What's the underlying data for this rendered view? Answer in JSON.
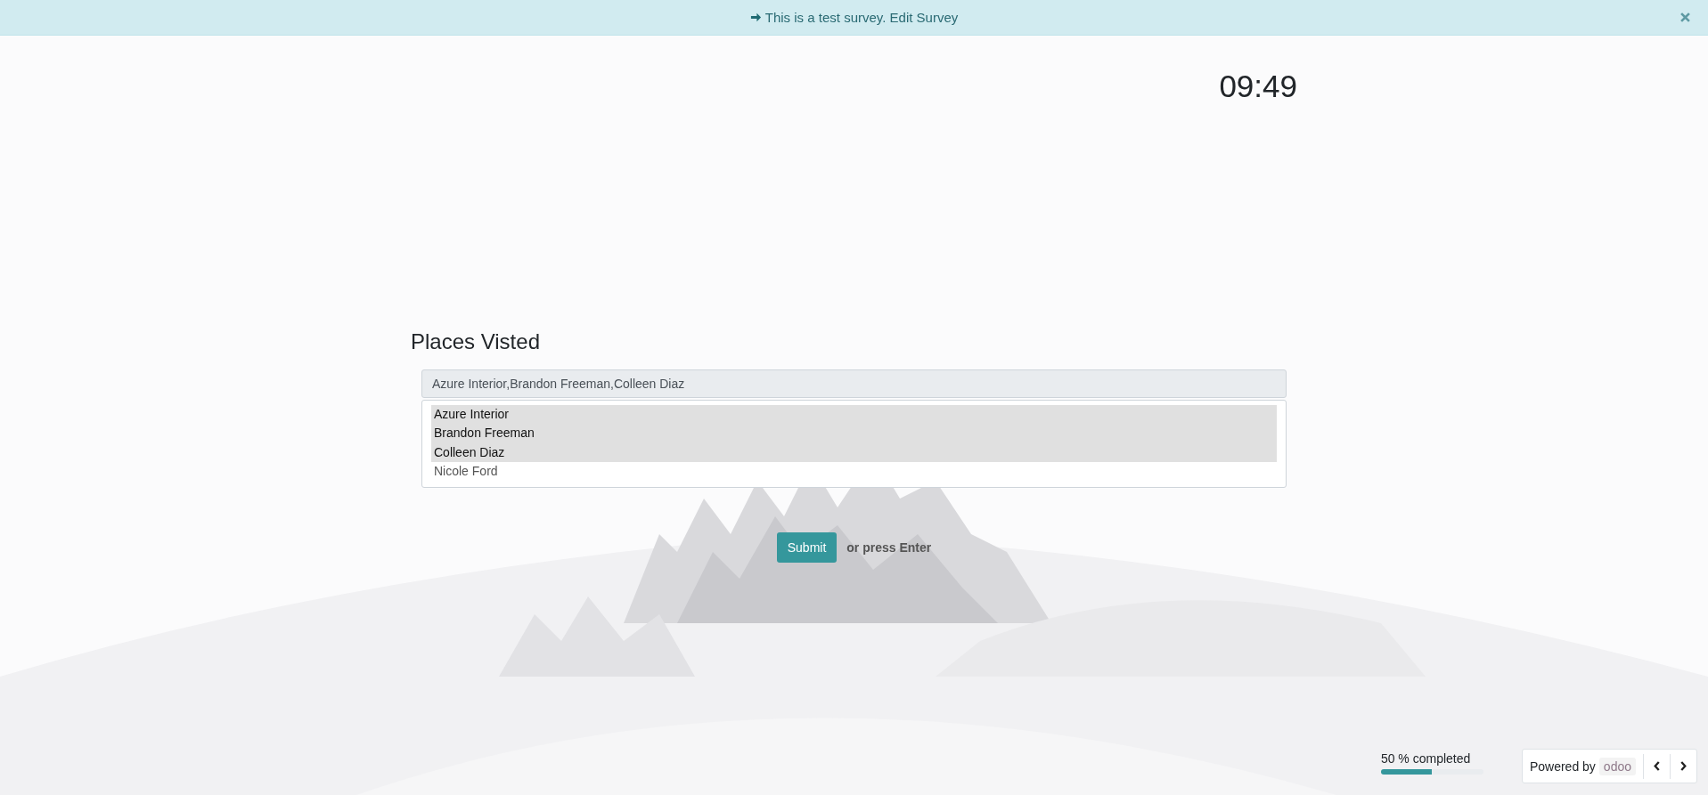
{
  "banner": {
    "message": "This is a test survey.",
    "link": "Edit Survey"
  },
  "timer": "09:49",
  "question": {
    "title": "Places Visted",
    "value": "Azure Interior,Brandon Freeman,Colleen Diaz",
    "options": [
      {
        "label": "Azure Interior",
        "selected": true
      },
      {
        "label": "Brandon Freeman",
        "selected": true
      },
      {
        "label": "Colleen Diaz",
        "selected": true
      },
      {
        "label": "Nicole Ford",
        "selected": false
      }
    ]
  },
  "submit": {
    "label": "Submit",
    "hint": "or press Enter"
  },
  "progress": {
    "label": "50 % completed",
    "level": 0.5
  },
  "footer": {
    "powered_by": "Powered by",
    "brand": "odoo"
  }
}
